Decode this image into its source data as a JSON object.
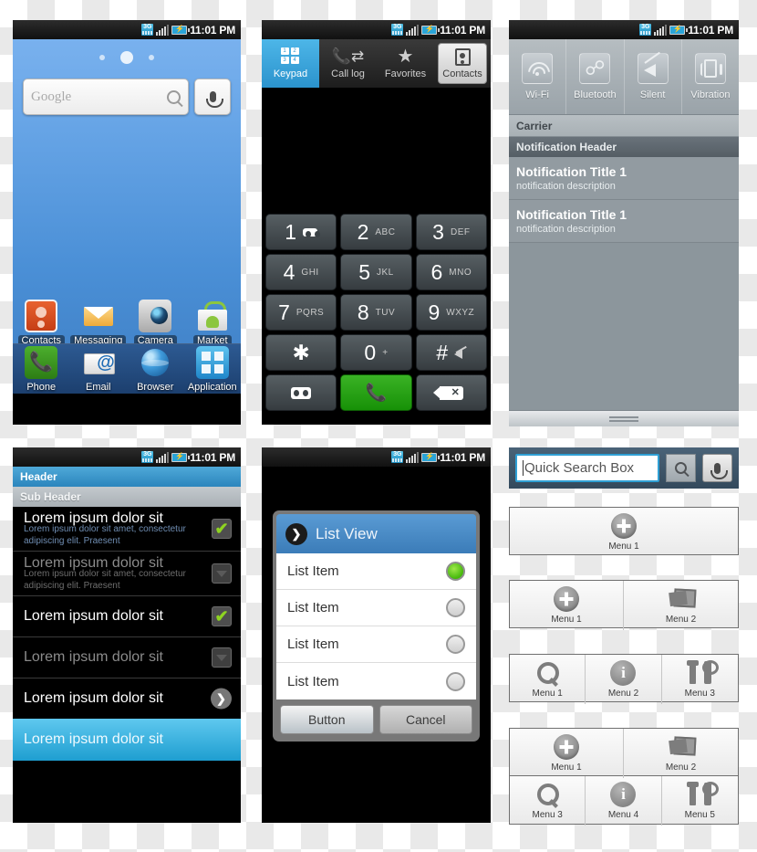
{
  "status_bar": {
    "time": "11:01 PM",
    "network": "3G",
    "signal_icon": "signal-bars-icon",
    "battery_icon": "battery-charging-icon"
  },
  "home_screen": {
    "search": {
      "placeholder": "Google",
      "search_icon": "search-icon",
      "mic_icon": "microphone-icon"
    },
    "page_dots": 3,
    "apps": [
      {
        "label": "Contacts",
        "icon": "contacts-icon"
      },
      {
        "label": "Messaging",
        "icon": "messaging-icon"
      },
      {
        "label": "Camera",
        "icon": "camera-icon"
      },
      {
        "label": "Market",
        "icon": "market-icon"
      }
    ],
    "dock": [
      {
        "label": "Phone",
        "icon": "phone-icon"
      },
      {
        "label": "Email",
        "icon": "email-icon"
      },
      {
        "label": "Browser",
        "icon": "browser-icon"
      },
      {
        "label": "Application",
        "icon": "application-grid-icon"
      }
    ]
  },
  "dialer": {
    "tabs": [
      {
        "label": "Keypad",
        "icon": "keypad-icon",
        "active": true
      },
      {
        "label": "Call log",
        "icon": "call-log-icon",
        "active": false
      },
      {
        "label": "Favorites",
        "icon": "star-icon",
        "active": false
      },
      {
        "label": "Contacts",
        "icon": "contacts-card-icon",
        "active": false
      }
    ],
    "keys": [
      {
        "num": "1",
        "sub": "",
        "icon": "voicemail-icon"
      },
      {
        "num": "2",
        "sub": "ABC",
        "icon": ""
      },
      {
        "num": "3",
        "sub": "DEF",
        "icon": ""
      },
      {
        "num": "4",
        "sub": "GHI",
        "icon": ""
      },
      {
        "num": "5",
        "sub": "JKL",
        "icon": ""
      },
      {
        "num": "6",
        "sub": "MNO",
        "icon": ""
      },
      {
        "num": "7",
        "sub": "PQRS",
        "icon": ""
      },
      {
        "num": "8",
        "sub": "TUV",
        "icon": ""
      },
      {
        "num": "9",
        "sub": "WXYZ",
        "icon": ""
      },
      {
        "num": "✱",
        "sub": "",
        "icon": ""
      },
      {
        "num": "0",
        "sub": "+",
        "icon": ""
      },
      {
        "num": "#",
        "sub": "",
        "icon": "mute-icon"
      }
    ],
    "action_keys": [
      {
        "icon": "voicemail-icon",
        "label": ""
      },
      {
        "icon": "call-icon",
        "label": ""
      },
      {
        "icon": "backspace-icon",
        "label": ""
      }
    ]
  },
  "notifications": {
    "toggles": [
      {
        "label": "Wi-Fi",
        "icon": "wifi-icon"
      },
      {
        "label": "Bluetooth",
        "icon": "bluetooth-icon"
      },
      {
        "label": "Silent",
        "icon": "silent-icon"
      },
      {
        "label": "Vibration",
        "icon": "vibration-icon"
      }
    ],
    "carrier": "Carrier",
    "section_header": "Notification Header",
    "items": [
      {
        "title": "Notification Title 1",
        "description": "notification description"
      },
      {
        "title": "Notification Title 1",
        "description": "notification description"
      }
    ],
    "handle_icon": "drag-handle-icon"
  },
  "list_screen": {
    "header": "Header",
    "sub_header": "Sub Header",
    "rows": [
      {
        "title": "Lorem ipsum dolor sit",
        "desc": "Lorem ipsum dolor sit amet, consectetur adipiscing elit. Praesent",
        "control": "checkbox",
        "checked": true,
        "dim": false
      },
      {
        "title": "Lorem ipsum dolor sit",
        "desc": "Lorem ipsum dolor sit amet, consectetur adipiscing elit. Praesent",
        "control": "checkbox",
        "checked": false,
        "dim": true
      },
      {
        "title": "Lorem ipsum dolor sit",
        "desc": "",
        "control": "checkbox",
        "checked": true,
        "dim": false
      },
      {
        "title": "Lorem ipsum dolor sit",
        "desc": "",
        "control": "checkbox",
        "checked": false,
        "dim": true
      },
      {
        "title": "Lorem ipsum dolor sit",
        "desc": "",
        "control": "chevron",
        "checked": false,
        "dim": false
      },
      {
        "title": "Lorem ipsum dolor sit",
        "desc": "",
        "control": "none",
        "checked": false,
        "dim": false,
        "selected": true
      }
    ]
  },
  "dialog_screen": {
    "title": "List View",
    "title_icon": "chevron-right-icon",
    "items": [
      {
        "label": "List Item",
        "selected": true
      },
      {
        "label": "List Item",
        "selected": false
      },
      {
        "label": "List Item",
        "selected": false
      },
      {
        "label": "List Item",
        "selected": false
      }
    ],
    "buttons": [
      {
        "label": "Button",
        "kind": "primary"
      },
      {
        "label": "Cancel",
        "kind": "secondary"
      }
    ]
  },
  "right_column": {
    "quick_search": {
      "value": "Quick Search Box",
      "search_icon": "search-icon",
      "mic_icon": "microphone-icon"
    },
    "menu_panels": [
      {
        "columns": 1,
        "cells": [
          {
            "label": "Menu 1",
            "icon": "plus-circle-icon"
          }
        ]
      },
      {
        "columns": 2,
        "cells": [
          {
            "label": "Menu 1",
            "icon": "plus-circle-icon"
          },
          {
            "label": "Menu 2",
            "icon": "gallery-icon"
          }
        ]
      },
      {
        "columns": 3,
        "cells": [
          {
            "label": "Menu 1",
            "icon": "search-icon"
          },
          {
            "label": "Menu 2",
            "icon": "info-circle-icon"
          },
          {
            "label": "Menu 3",
            "icon": "tools-icon"
          }
        ]
      },
      {
        "columns": 2,
        "cells": [
          {
            "label": "Menu 1",
            "icon": "plus-circle-icon"
          },
          {
            "label": "Menu 2",
            "icon": "gallery-icon"
          }
        ]
      },
      {
        "columns": 3,
        "cells": [
          {
            "label": "Menu 3",
            "icon": "search-icon"
          },
          {
            "label": "Menu 4",
            "icon": "info-circle-icon"
          },
          {
            "label": "Menu 5",
            "icon": "tools-icon"
          }
        ]
      }
    ]
  },
  "colors": {
    "accent_blue": "#2b93cd",
    "selected_blue": "#1e9ed0",
    "green": "#2d7d14",
    "check_green": "#8ed321"
  }
}
